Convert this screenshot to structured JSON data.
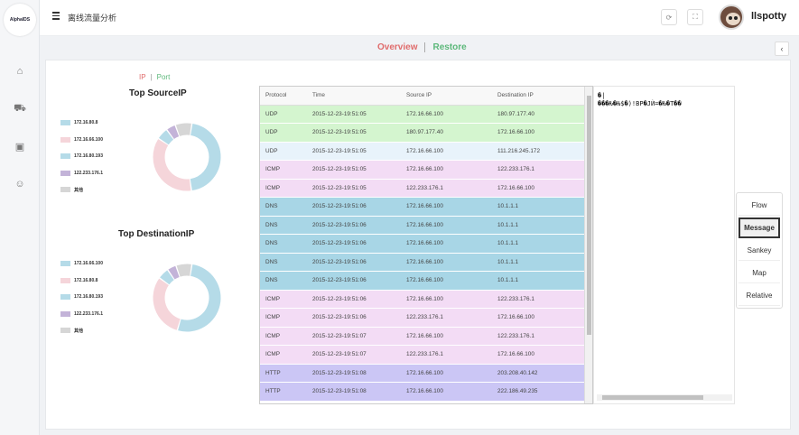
{
  "app": {
    "logo_text": "AlphaIDS"
  },
  "header": {
    "title": "离线流量分析",
    "username": "llspotty"
  },
  "tabs": {
    "overview": "Overview",
    "restore": "Restore"
  },
  "toggle": {
    "ip": "IP",
    "sep": "|",
    "port": "Port"
  },
  "source_chart": {
    "title": "Top SourceIP",
    "legend": [
      "172.16.80.8",
      "172.16.66.100",
      "172.16.80.193",
      "122.233.176.1",
      "其他"
    ]
  },
  "dest_chart": {
    "title": "Top DestinationIP",
    "legend": [
      "172.16.66.100",
      "172.16.80.8",
      "172.16.80.193",
      "122.233.176.1",
      "其他"
    ]
  },
  "chart_data": [
    {
      "type": "pie",
      "title": "Top SourceIP",
      "categories": [
        "172.16.80.8",
        "172.16.66.100",
        "172.16.80.193",
        "122.233.176.1",
        "其他"
      ],
      "values": [
        40,
        32,
        5,
        4,
        7
      ],
      "colors": [
        "#b5dbe8",
        "#f5d5da",
        "#b5dbe8",
        "#c3b3d8",
        "#d6d6d6"
      ]
    },
    {
      "type": "pie",
      "title": "Top DestinationIP",
      "categories": [
        "172.16.66.100",
        "172.16.80.8",
        "172.16.80.193",
        "122.233.176.1",
        "其他"
      ],
      "values": [
        48,
        28,
        5,
        4,
        7
      ],
      "colors": [
        "#b5dbe8",
        "#f5d5da",
        "#b5dbe8",
        "#c3b3d8",
        "#d6d6d6"
      ]
    }
  ],
  "table": {
    "columns": [
      "Protocol",
      "Time",
      "Source IP",
      "Destination IP"
    ],
    "rows": [
      {
        "protocol": "UDP",
        "time": "2015-12-23-19:51:05",
        "src": "172.16.66.100",
        "dst": "180.97.177.40",
        "color": "#d4f5cf"
      },
      {
        "protocol": "UDP",
        "time": "2015-12-23-19:51:05",
        "src": "180.97.177.40",
        "dst": "172.16.66.100",
        "color": "#d4f5cf"
      },
      {
        "protocol": "UDP",
        "time": "2015-12-23-19:51:05",
        "src": "172.16.66.100",
        "dst": "111.216.245.172",
        "color": "#e8f3fb"
      },
      {
        "protocol": "ICMP",
        "time": "2015-12-23-19:51:05",
        "src": "172.16.66.100",
        "dst": "122.233.176.1",
        "color": "#f3dcf5"
      },
      {
        "protocol": "ICMP",
        "time": "2015-12-23-19:51:05",
        "src": "122.233.176.1",
        "dst": "172.16.66.100",
        "color": "#f3dcf5"
      },
      {
        "protocol": "DNS",
        "time": "2015-12-23-19:51:06",
        "src": "172.16.66.100",
        "dst": "10.1.1.1",
        "color": "#a8d6e6"
      },
      {
        "protocol": "DNS",
        "time": "2015-12-23-19:51:06",
        "src": "172.16.66.100",
        "dst": "10.1.1.1",
        "color": "#a8d6e6"
      },
      {
        "protocol": "DNS",
        "time": "2015-12-23-19:51:06",
        "src": "172.16.66.100",
        "dst": "10.1.1.1",
        "color": "#a8d6e6"
      },
      {
        "protocol": "DNS",
        "time": "2015-12-23-19:51:06",
        "src": "172.16.66.100",
        "dst": "10.1.1.1",
        "color": "#a8d6e6"
      },
      {
        "protocol": "DNS",
        "time": "2015-12-23-19:51:06",
        "src": "172.16.66.100",
        "dst": "10.1.1.1",
        "color": "#a8d6e6"
      },
      {
        "protocol": "ICMP",
        "time": "2015-12-23-19:51:06",
        "src": "172.16.66.100",
        "dst": "122.233.176.1",
        "color": "#f3dcf5"
      },
      {
        "protocol": "ICMP",
        "time": "2015-12-23-19:51:06",
        "src": "122.233.176.1",
        "dst": "172.16.66.100",
        "color": "#f3dcf5"
      },
      {
        "protocol": "ICMP",
        "time": "2015-12-23-19:51:07",
        "src": "172.16.66.100",
        "dst": "122.233.176.1",
        "color": "#f3dcf5"
      },
      {
        "protocol": "ICMP",
        "time": "2015-12-23-19:51:07",
        "src": "122.233.176.1",
        "dst": "172.16.66.100",
        "color": "#f3dcf5"
      },
      {
        "protocol": "HTTP",
        "time": "2015-12-23-19:51:08",
        "src": "172.16.66.100",
        "dst": "203.208.40.142",
        "color": "#cbc6f5"
      },
      {
        "protocol": "HTTP",
        "time": "2015-12-23-19:51:08",
        "src": "172.16.66.100",
        "dst": "222.186.49.235",
        "color": "#cbc6f5"
      }
    ]
  },
  "message": {
    "text": "�|\n���Ƕ�Ƕ$�)!BP�JЍ=�Ƕ�T��"
  },
  "side_menu": [
    "Flow",
    "Message",
    "Sankey",
    "Map",
    "Relative"
  ],
  "side_menu_active": "Message"
}
